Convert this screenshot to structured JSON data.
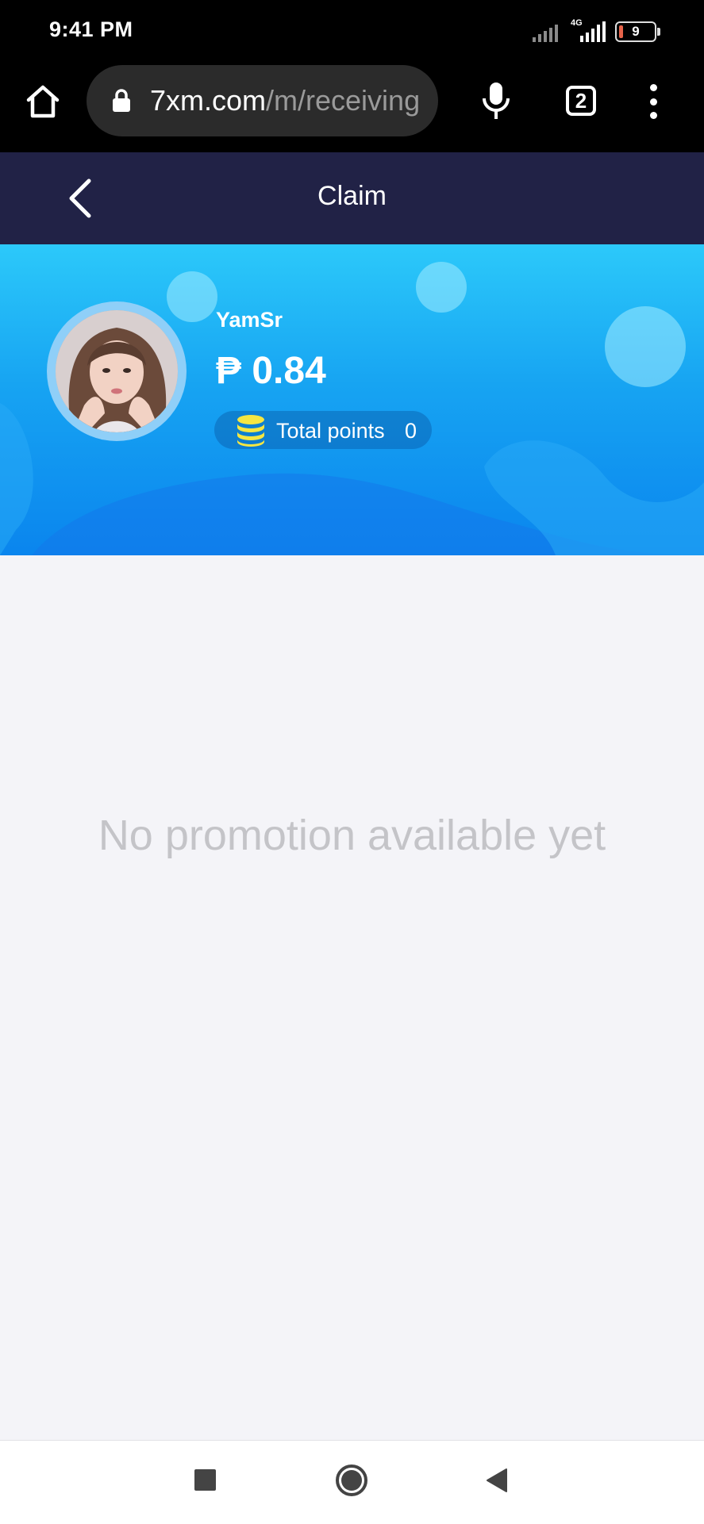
{
  "status_bar": {
    "time": "9:41 PM",
    "network_label": "4G",
    "battery_level": "9"
  },
  "browser": {
    "url_domain": "7xm.com",
    "url_path": "/m/receiving",
    "tab_count": "2",
    "icons": [
      "home-icon",
      "lock-icon",
      "microphone-icon",
      "tabs-icon",
      "more-menu-icon"
    ]
  },
  "header": {
    "title": "Claim",
    "back_icon": "chevron-left-icon"
  },
  "profile": {
    "username": "YamSr",
    "balance": "₱ 0.84",
    "points_label": "Total points",
    "points_value": "0",
    "points_icon": "coin-stack-icon"
  },
  "main": {
    "empty_message": "No promotion available yet"
  },
  "nav_bar": {
    "icons": [
      "recent-apps-icon",
      "home-circle-icon",
      "back-triangle-icon"
    ]
  },
  "colors": {
    "header_bg": "#212246",
    "hero_top": "#2cc9fa",
    "hero_bottom": "#0a85ee",
    "page_bg": "#f4f4f8",
    "empty_text": "#c4c4c8",
    "coin": "#f5e642"
  }
}
